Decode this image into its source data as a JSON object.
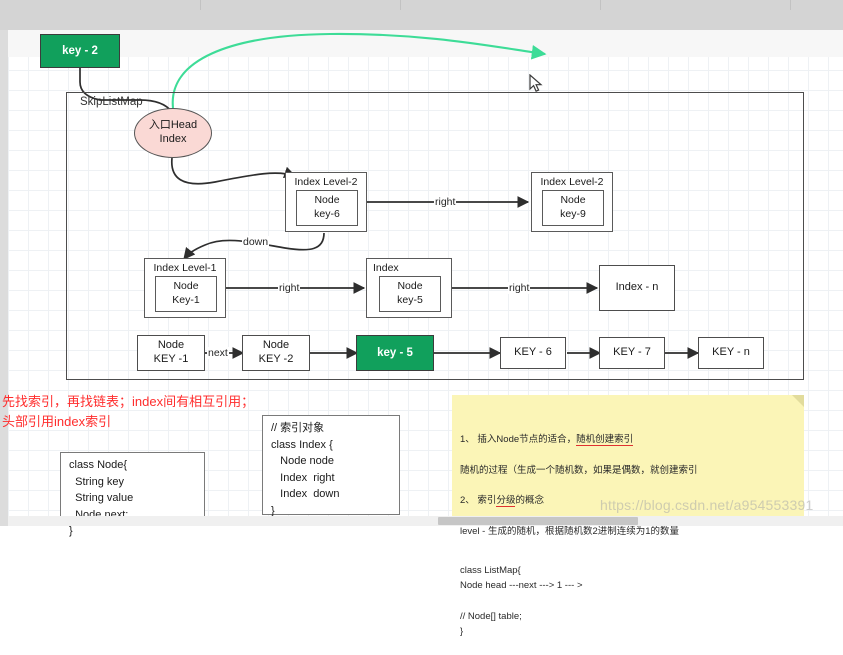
{
  "app": {
    "watermark": "https://blog.csdn.net/a954553391"
  },
  "diagram": {
    "container_label": "SkipListMap",
    "head": {
      "label": "入口Head\nIndex"
    },
    "external_key_box": {
      "label": "key - 2"
    },
    "level2": {
      "left": {
        "title": "Index  Level-2",
        "node": "Node\nkey-6"
      },
      "right": {
        "title": "Index  Level-2",
        "node": "Node\nkey-9"
      },
      "edge_label": "right"
    },
    "level1": {
      "left": {
        "title": "Index Level-1",
        "node": "Node\nKey-1"
      },
      "middle": {
        "title": "Index",
        "node": "Node\nkey-5"
      },
      "right": {
        "title": "Index - n"
      },
      "edge_label_left": "right",
      "edge_label_right": "right"
    },
    "down_label": "down",
    "next_label": "next",
    "linked_list": [
      {
        "label": "Node\nKEY -1",
        "style": "plain"
      },
      {
        "label": "Node\nKEY -2",
        "style": "plain"
      },
      {
        "label": "key - 5",
        "style": "green"
      },
      {
        "label": "KEY - 6",
        "style": "plain"
      },
      {
        "label": "KEY - 7",
        "style": "plain"
      },
      {
        "label": "KEY - n",
        "style": "plain"
      }
    ]
  },
  "notes": {
    "red": "先找索引，再找链表；index间有相互引用；\n头部引用index索引",
    "index_code": "// 索引对象\nclass Index {\n   Node node\n   Index  right\n   Index  down\n}",
    "node_code": "class Node{\n  String key\n  String value\n  Node next;\n}",
    "yellow_line1_a": "1、 插入Node节点的适合，",
    "yellow_line1_b": "随机创建索引",
    "yellow_line2": "随机的过程（生成一个随机数，如果是偶数，就创建索引",
    "yellow_line3_a": "2、 索引",
    "yellow_line3_b": "分级",
    "yellow_line3_c": "的概念",
    "yellow_line4": "level -  生成的随机，根据随机数2进制连续为1的数量",
    "yellow_code": "class ListMap{\n  Node head  ---next --->   1 --- >\n\n // Node[] table;\n}"
  },
  "colors": {
    "green": "#11a05c",
    "head_pink": "#fad9d5",
    "note_yellow": "#fbf5b7",
    "red_text": "#ff2d2d",
    "green_arrow": "#3ddc97"
  }
}
